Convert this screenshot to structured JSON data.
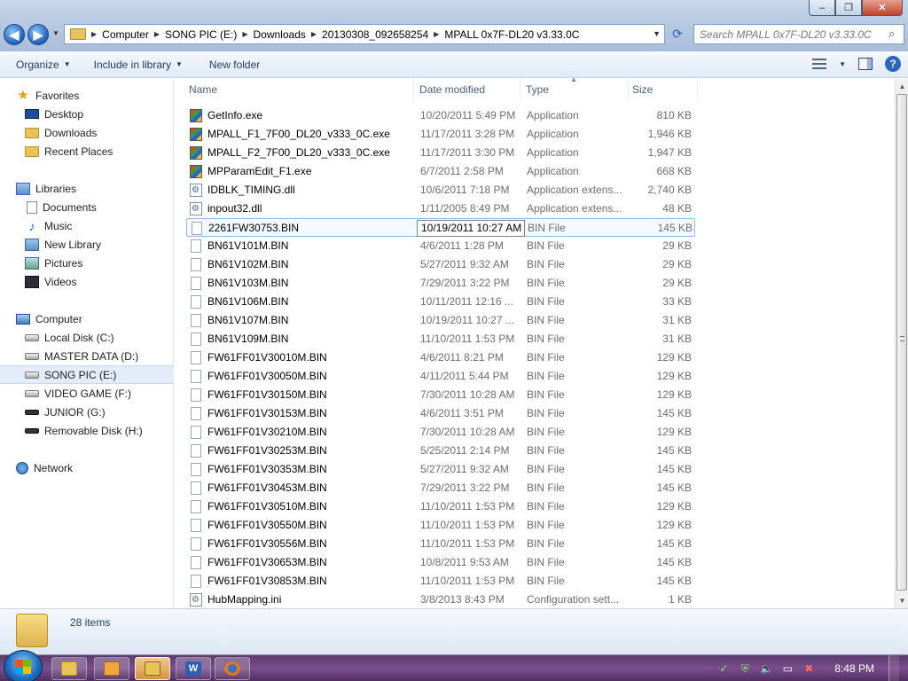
{
  "window": {
    "controls": {
      "minimize": "–",
      "maximize": "❐",
      "close": "✕"
    }
  },
  "address": {
    "crumbs": [
      "Computer",
      "SONG PIC (E:)",
      "Downloads",
      "20130308_092658254",
      "MPALL 0x7F-DL20 v3.33.0C"
    ]
  },
  "search": {
    "placeholder": "Search MPALL 0x7F-DL20 v3.33.0C"
  },
  "toolbar": {
    "organize": "Organize",
    "include_in_library": "Include in library",
    "new_folder": "New folder"
  },
  "nav": {
    "favorites": "Favorites",
    "desktop": "Desktop",
    "downloads": "Downloads",
    "recent_places": "Recent Places",
    "libraries": "Libraries",
    "documents": "Documents",
    "music": "Music",
    "new_library": "New Library",
    "pictures": "Pictures",
    "videos": "Videos",
    "computer": "Computer",
    "drive_c": "Local Disk (C:)",
    "drive_d": "MASTER DATA (D:)",
    "drive_e": "SONG PIC (E:)",
    "drive_f": "VIDEO GAME (F:)",
    "drive_g": "JUNIOR (G:)",
    "drive_h": "Removable Disk (H:)",
    "network": "Network"
  },
  "columns": {
    "name": "Name",
    "date": "Date modified",
    "type": "Type",
    "size": "Size"
  },
  "files": [
    {
      "name": "GetInfo.exe",
      "date": "10/20/2011 5:49 PM",
      "type": "Application",
      "size": "810 KB",
      "icon": "exe"
    },
    {
      "name": "MPALL_F1_7F00_DL20_v333_0C.exe",
      "date": "11/17/2011 3:28 PM",
      "type": "Application",
      "size": "1,946 KB",
      "icon": "exe"
    },
    {
      "name": "MPALL_F2_7F00_DL20_v333_0C.exe",
      "date": "11/17/2011 3:30 PM",
      "type": "Application",
      "size": "1,947 KB",
      "icon": "exe"
    },
    {
      "name": "MPParamEdit_F1.exe",
      "date": "6/7/2011 2:58 PM",
      "type": "Application",
      "size": "668 KB",
      "icon": "exe"
    },
    {
      "name": "IDBLK_TIMING.dll",
      "date": "10/6/2011 7:18 PM",
      "type": "Application extens...",
      "size": "2,740 KB",
      "icon": "dll"
    },
    {
      "name": "inpout32.dll",
      "date": "1/11/2005 8:49 PM",
      "type": "Application extens...",
      "size": "48 KB",
      "icon": "dll"
    },
    {
      "name": "2261FW30753.BIN",
      "date": "10/19/2011 10:27 AM",
      "type": "BIN File",
      "size": "145 KB",
      "icon": "bin"
    },
    {
      "name": "BN61V101M.BIN",
      "date": "4/6/2011 1:28 PM",
      "type": "BIN File",
      "size": "29 KB",
      "icon": "bin"
    },
    {
      "name": "BN61V102M.BIN",
      "date": "5/27/2011 9:32 AM",
      "type": "BIN File",
      "size": "29 KB",
      "icon": "bin"
    },
    {
      "name": "BN61V103M.BIN",
      "date": "7/29/2011 3:22 PM",
      "type": "BIN File",
      "size": "29 KB",
      "icon": "bin"
    },
    {
      "name": "BN61V106M.BIN",
      "date": "10/11/2011 12:16 ...",
      "type": "BIN File",
      "size": "33 KB",
      "icon": "bin"
    },
    {
      "name": "BN61V107M.BIN",
      "date": "10/19/2011 10:27 ...",
      "type": "BIN File",
      "size": "31 KB",
      "icon": "bin"
    },
    {
      "name": "BN61V109M.BIN",
      "date": "11/10/2011 1:53 PM",
      "type": "BIN File",
      "size": "31 KB",
      "icon": "bin"
    },
    {
      "name": "FW61FF01V30010M.BIN",
      "date": "4/6/2011 8:21 PM",
      "type": "BIN File",
      "size": "129 KB",
      "icon": "bin"
    },
    {
      "name": "FW61FF01V30050M.BIN",
      "date": "4/11/2011 5:44 PM",
      "type": "BIN File",
      "size": "129 KB",
      "icon": "bin"
    },
    {
      "name": "FW61FF01V30150M.BIN",
      "date": "7/30/2011 10:28 AM",
      "type": "BIN File",
      "size": "129 KB",
      "icon": "bin"
    },
    {
      "name": "FW61FF01V30153M.BIN",
      "date": "4/6/2011 3:51 PM",
      "type": "BIN File",
      "size": "145 KB",
      "icon": "bin"
    },
    {
      "name": "FW61FF01V30210M.BIN",
      "date": "7/30/2011 10:28 AM",
      "type": "BIN File",
      "size": "129 KB",
      "icon": "bin"
    },
    {
      "name": "FW61FF01V30253M.BIN",
      "date": "5/25/2011 2:14 PM",
      "type": "BIN File",
      "size": "145 KB",
      "icon": "bin"
    },
    {
      "name": "FW61FF01V30353M.BIN",
      "date": "5/27/2011 9:32 AM",
      "type": "BIN File",
      "size": "145 KB",
      "icon": "bin"
    },
    {
      "name": "FW61FF01V30453M.BIN",
      "date": "7/29/2011 3:22 PM",
      "type": "BIN File",
      "size": "145 KB",
      "icon": "bin"
    },
    {
      "name": "FW61FF01V30510M.BIN",
      "date": "11/10/2011 1:53 PM",
      "type": "BIN File",
      "size": "129 KB",
      "icon": "bin"
    },
    {
      "name": "FW61FF01V30550M.BIN",
      "date": "11/10/2011 1:53 PM",
      "type": "BIN File",
      "size": "129 KB",
      "icon": "bin"
    },
    {
      "name": "FW61FF01V30556M.BIN",
      "date": "11/10/2011 1:53 PM",
      "type": "BIN File",
      "size": "145 KB",
      "icon": "bin"
    },
    {
      "name": "FW61FF01V30653M.BIN",
      "date": "10/8/2011 9:53 AM",
      "type": "BIN File",
      "size": "145 KB",
      "icon": "bin"
    },
    {
      "name": "FW61FF01V30853M.BIN",
      "date": "11/10/2011 1:53 PM",
      "type": "BIN File",
      "size": "145 KB",
      "icon": "bin"
    },
    {
      "name": "HubMapping.ini",
      "date": "3/8/2013 8:43 PM",
      "type": "Configuration sett...",
      "size": "1 KB",
      "icon": "ini"
    }
  ],
  "details": {
    "count": "28 items"
  },
  "taskbar": {
    "clock": "8:48 PM"
  },
  "colors": {
    "accent": "#2a66c2",
    "taskbar": "#6a4580",
    "selection": "#e3ecf8"
  }
}
